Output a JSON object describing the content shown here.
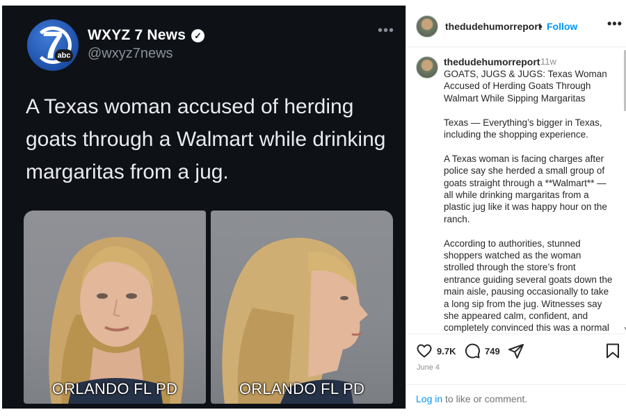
{
  "tweet": {
    "account_name": "WXYZ 7 News",
    "handle": "@wxyz7news",
    "logo_number": "7",
    "logo_badge": "abc",
    "more_icon": "more-horizontal-icon",
    "verified_icon": "verified-check-icon",
    "text": "A Texas woman accused of herding goats through a Walmart while drinking margaritas from a jug.",
    "mugshot_labels": [
      "ORLANDO FL PD",
      "ORLANDO FL PD"
    ]
  },
  "post": {
    "header": {
      "username": "thedudehumorreport",
      "separator": "•",
      "follow_label": "Follow",
      "more_icon": "more-horizontal-icon"
    },
    "caption": {
      "username": "thedudehumorreport",
      "time_ago": "11w",
      "paragraphs": [
        "GOATS, JUGS & JUGS: Texas Woman Accused of Herding Goats Through Walmart While Sipping Margaritas",
        "Texas — Everything’s bigger in Texas, including the shopping experience.",
        "A Texas woman is facing charges after police say she herded a small group of goats straight through a **Walmart** — all while drinking margaritas from a plastic jug like it was happy hour on the ranch.",
        "According to authorities, stunned shoppers watched as the woman strolled through the store’s front entrance guiding several goats down the main aisle, pausing occasionally to take a long sip from the jug. Witnesses say she appeared calm, confident, and completely convinced this was a normal"
      ]
    },
    "actions": {
      "likes": "9.7K",
      "comments": "749",
      "like_icon": "heart-icon",
      "comment_icon": "comment-icon",
      "share_icon": "paper-plane-icon",
      "save_icon": "bookmark-icon"
    },
    "date": "June 4",
    "login": {
      "link_label": "Log in",
      "rest_text": "to like or comment."
    }
  },
  "colors": {
    "tweet_background": "#0e1217",
    "link_blue": "#0095f6",
    "text_dark": "#262626",
    "text_muted": "#8e8e8e"
  }
}
